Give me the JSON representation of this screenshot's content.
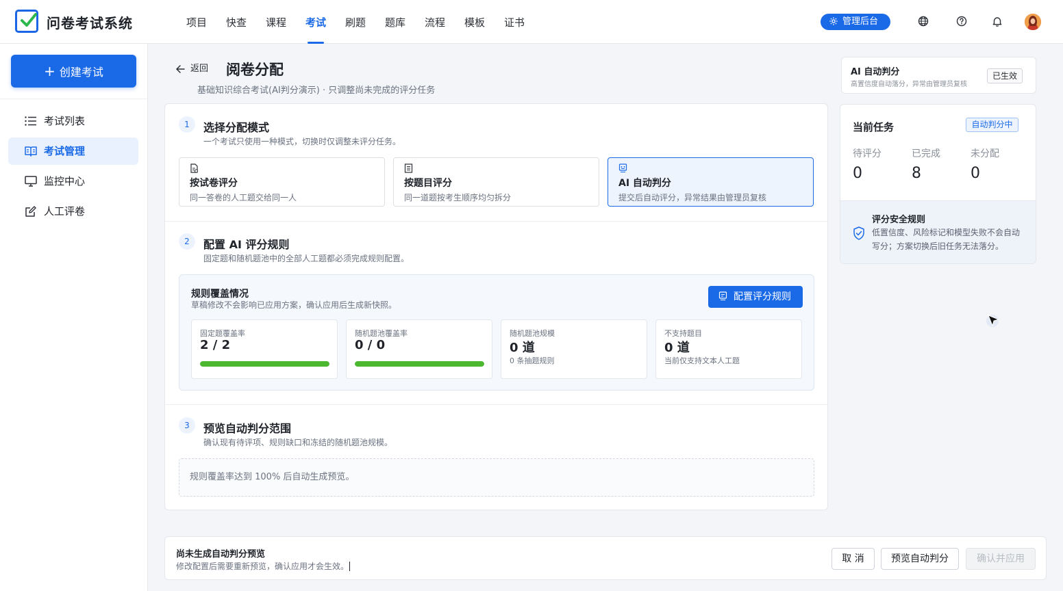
{
  "app": {
    "title": "问卷考试系统"
  },
  "nav": {
    "items": [
      "项目",
      "快查",
      "课程",
      "考试",
      "刷题",
      "题库",
      "流程",
      "模板",
      "证书"
    ],
    "active_index": 3
  },
  "header": {
    "admin_label": "管理后台"
  },
  "sidebar": {
    "create_label": "创建考试",
    "items": [
      {
        "label": "考试列表",
        "icon": "list-icon"
      },
      {
        "label": "考试管理",
        "icon": "book-open-icon",
        "active": true
      },
      {
        "label": "监控中心",
        "icon": "monitor-icon"
      },
      {
        "label": "人工评卷",
        "icon": "edit-icon"
      }
    ]
  },
  "page": {
    "back_label": "返回",
    "title": "阅卷分配",
    "subtitle": "基础知识综合考试(AI判分演示) · 只调整尚未完成的评分任务"
  },
  "steps": [
    {
      "num": "1",
      "title": "选择分配模式",
      "desc": "一个考试只使用一种模式，切换时仅调整未评分任务。"
    },
    {
      "num": "2",
      "title": "配置 AI 评分规则",
      "desc": "固定题和随机题池中的全部人工题都必须完成规则配置。"
    },
    {
      "num": "3",
      "title": "预览自动判分范围",
      "desc": "确认现有待评项、规则缺口和冻结的随机题池规模。"
    }
  ],
  "modes": [
    {
      "title": "按试卷评分",
      "desc": "同一答卷的人工题交给同一人",
      "icon": "paper-check-icon",
      "selected": false
    },
    {
      "title": "按题目评分",
      "desc": "同一道题按考生顺序均匀拆分",
      "icon": "list-doc-icon",
      "selected": false
    },
    {
      "title": "AI 自动判分",
      "desc": "提交后自动评分，异常结果由管理员复核",
      "icon": "robot-icon",
      "selected": true
    }
  ],
  "coverage": {
    "title": "规则覆盖情况",
    "desc": "草稿修改不会影响已应用方案，确认应用后生成新快照。",
    "config_button": "配置评分规则",
    "stats": [
      {
        "label": "固定题覆盖率",
        "value": "2 / 2",
        "progress": 1.0
      },
      {
        "label": "随机题池覆盖率",
        "value": "0 / 0",
        "progress": 1.0
      },
      {
        "label": "随机题池规模",
        "value": "0 道",
        "sub": "0 条抽题规则"
      },
      {
        "label": "不支持题目",
        "value": "0 道",
        "sub": "当前仅支持文本人工题"
      }
    ]
  },
  "preview": {
    "placeholder": "规则覆盖率达到 100% 后自动生成预览。"
  },
  "ai_status": {
    "title": "AI 自动判分",
    "desc": "高置信度自动落分，异常由管理员复核",
    "badge": "已生效"
  },
  "task": {
    "title": "当前任务",
    "badge": "自动判分中",
    "stats": [
      {
        "label": "待评分",
        "value": "0"
      },
      {
        "label": "已完成",
        "value": "8"
      },
      {
        "label": "未分配",
        "value": "0"
      }
    ],
    "safety_title": "评分安全规则",
    "safety_desc": "低置信度、风险标记和模型失败不会自动写分；方案切换后旧任务无法落分。"
  },
  "footer": {
    "title": "尚未生成自动判分预览",
    "desc": "修改配置后需要重新预览，确认应用才会生效。",
    "cancel": "取 消",
    "preview": "预览自动判分",
    "confirm": "确认并应用"
  },
  "colors": {
    "primary": "#1a6ae8",
    "progress": "#4cb82f"
  }
}
